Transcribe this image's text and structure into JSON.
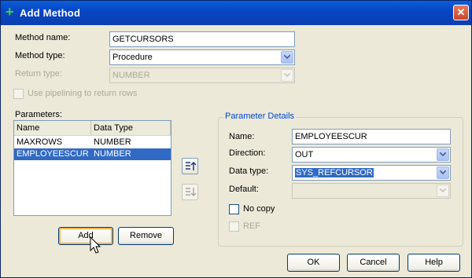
{
  "window": {
    "title": "Add Method",
    "title_icon": "plus-icon",
    "close_icon": "close-icon",
    "close_glyph": "✕"
  },
  "form": {
    "method_name_label": "Method name:",
    "method_name_value": "GETCURSORS",
    "method_type_label": "Method type:",
    "method_type_value": "Procedure",
    "return_type_label": "Return type:",
    "return_type_value": "NUMBER",
    "pipelining_label": "Use pipelining to return rows"
  },
  "parameters": {
    "label": "Parameters:",
    "columns": [
      "Name",
      "Data Type"
    ],
    "rows": [
      {
        "name": "MAXROWS",
        "type": "NUMBER"
      },
      {
        "name": "EMPLOYEESCUR",
        "type": "NUMBER",
        "selected": true
      }
    ],
    "add_label": "Add",
    "remove_label": "Remove"
  },
  "details": {
    "title": "Parameter Details",
    "name_label": "Name:",
    "name_value": "EMPLOYEESCUR",
    "direction_label": "Direction:",
    "direction_value": "OUT",
    "datatype_label": "Data type:",
    "datatype_value": "SYS_REFCURSOR",
    "default_label": "Default:",
    "default_value": "",
    "nocopy_label": "No copy",
    "ref_label": "REF"
  },
  "footer": {
    "ok_label": "OK",
    "cancel_label": "Cancel",
    "help_label": "Help"
  },
  "colors": {
    "titlebar": "#0846c4",
    "selection": "#316ac5",
    "group_title": "#0046d5"
  }
}
